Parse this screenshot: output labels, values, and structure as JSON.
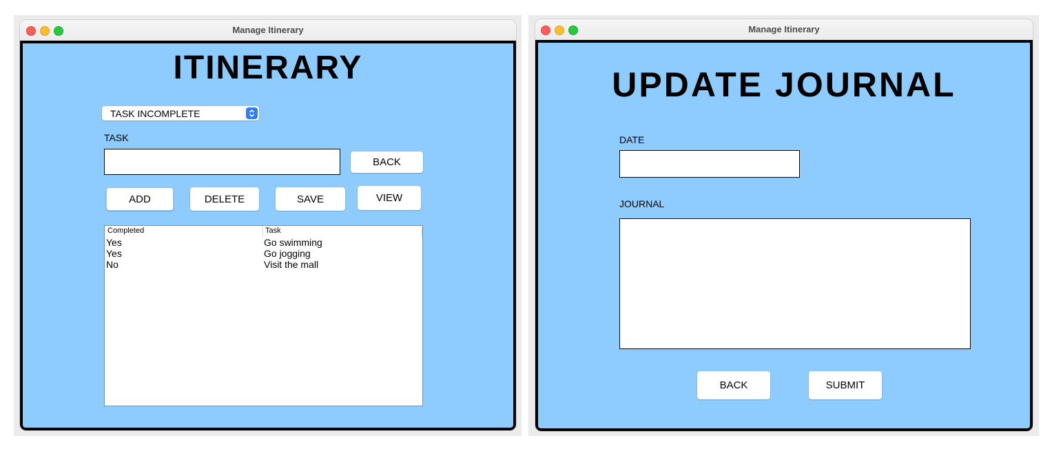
{
  "itinerary_window": {
    "title": "Manage Itinerary",
    "heading": "ITINERARY",
    "filter_select": {
      "selected": "TASK INCOMPLETE"
    },
    "task_label": "TASK",
    "task_input": {
      "value": "",
      "placeholder": ""
    },
    "buttons": {
      "back": "BACK",
      "add": "ADD",
      "delete": "DELETE",
      "save": "SAVE",
      "view": "VIEW"
    },
    "table": {
      "columns": [
        "Completed",
        "Task"
      ],
      "rows": [
        [
          "Yes",
          "Go swimming"
        ],
        [
          "Yes",
          "Go jogging"
        ],
        [
          "No",
          "Visit the mall"
        ]
      ]
    }
  },
  "journal_window": {
    "title": "Manage Itinerary",
    "heading": "UPDATE JOURNAL",
    "date_label": "DATE",
    "date_input": {
      "value": "",
      "placeholder": ""
    },
    "journal_label": "JOURNAL",
    "journal_input": {
      "value": "",
      "placeholder": ""
    },
    "buttons": {
      "back": "BACK",
      "submit": "SUBMIT"
    }
  },
  "icons": [
    "close-icon",
    "minimize-icon",
    "zoom-icon",
    "chevron-up-down-icon"
  ],
  "colors": {
    "panel_background": "#8ecbff",
    "panel_border": "#000000",
    "accent": "#2f7df6",
    "traffic_red": "#ff5f57",
    "traffic_yellow": "#febc2e",
    "traffic_green": "#28c840"
  }
}
